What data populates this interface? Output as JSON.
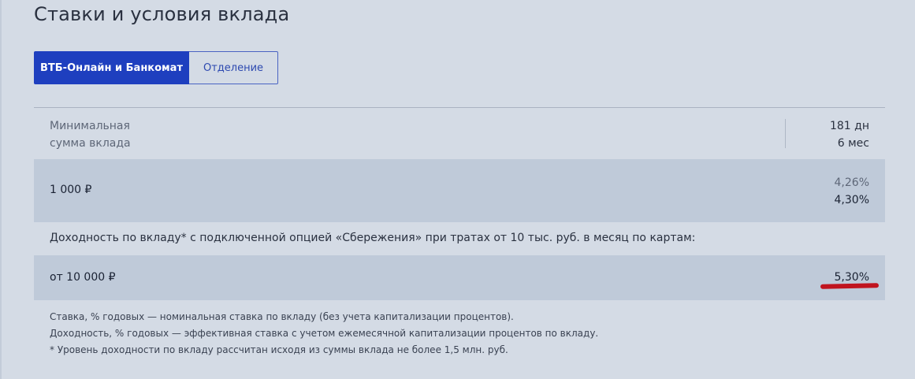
{
  "page": {
    "title": "Ставки и условия вклада"
  },
  "tabs": [
    {
      "label": "ВТБ-Онлайн и Банкомат",
      "active": true
    },
    {
      "label": "Отделение",
      "active": false
    }
  ],
  "table": {
    "header_label_line1": "Минимальная",
    "header_label_line2": "сумма вклада",
    "term_days": "181 дн",
    "term_months": "6 мес",
    "rows": [
      {
        "amount": "1 000 ₽",
        "rate_nominal": "4,26%",
        "rate_effective": "4,30%"
      }
    ],
    "option_note": "Доходность по вкладу* с подключенной опцией «Сбережения» при тратах от 10 тыс. руб. в месяц по картам:",
    "option_rows": [
      {
        "amount": "от 10 000 ₽",
        "rate": "5,30%"
      }
    ]
  },
  "footnotes": [
    "Ставка, % годовых — номинальная ставка по вкладу (без учета капитализации процентов).",
    "Доходность, % годовых — эффективная ставка с учетом ежемесячной капитализации процентов по вкладу.",
    "* Уровень доходности по вкладу рассчитан исходя из суммы вклада не более 1,5 млн. руб."
  ],
  "colors": {
    "accent": "#1e3fbf",
    "background": "#d4dbe5",
    "row_background": "#bfcad9",
    "annotation_mark": "#c0141f"
  }
}
